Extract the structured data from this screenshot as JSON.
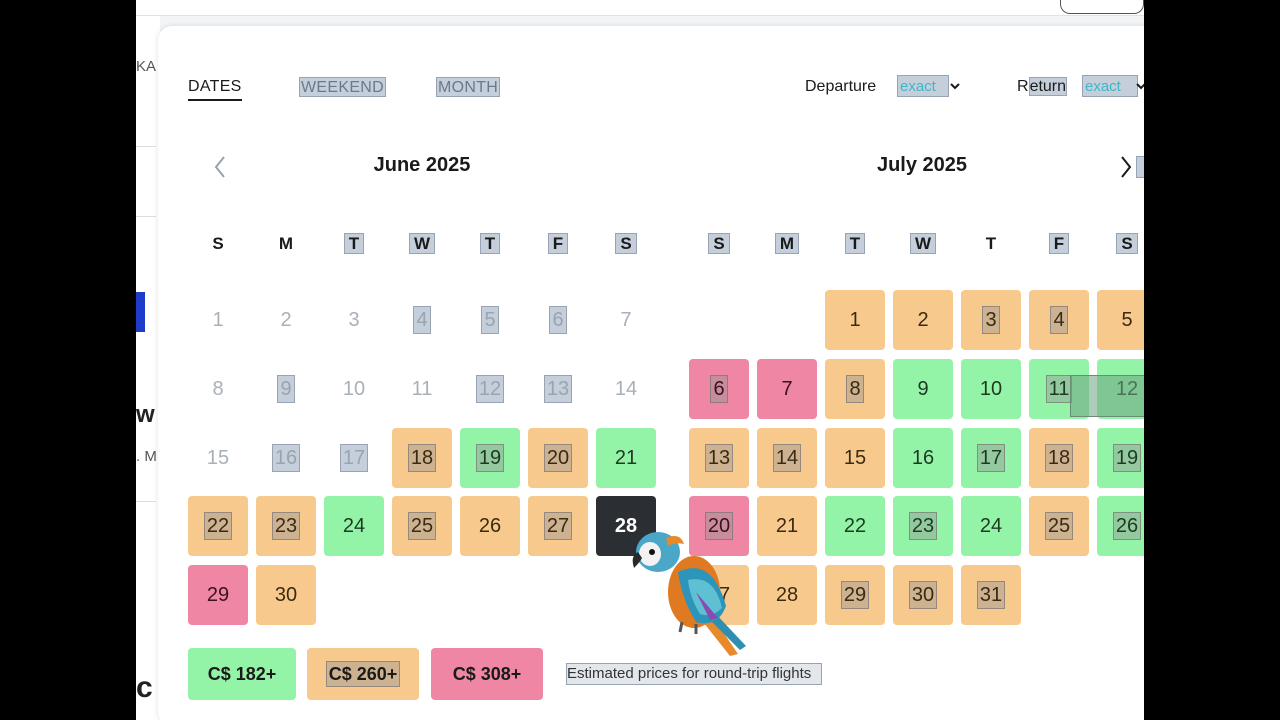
{
  "tabs": [
    {
      "label": "DATES",
      "active": true
    },
    {
      "label": "WEEKEND",
      "active": false
    },
    {
      "label": "MONTH",
      "active": false
    }
  ],
  "flex": {
    "departure_label": "Departure",
    "departure_value": "exact",
    "return_label_pre": "R",
    "return_label_rest": "eturn",
    "return_value": "exact"
  },
  "background_fragments": {
    "ka": "KA",
    "w": "w",
    "m": ". M",
    "c": "c"
  },
  "calendars": [
    {
      "title": "June 2025",
      "weekdays": [
        "S",
        "M",
        "T",
        "W",
        "T",
        "F",
        "S"
      ],
      "days": [
        {
          "d": "1",
          "price": "past"
        },
        {
          "d": "2",
          "price": "past"
        },
        {
          "d": "3",
          "price": "past"
        },
        {
          "d": "4",
          "price": "past"
        },
        {
          "d": "5",
          "price": "past"
        },
        {
          "d": "6",
          "price": "past"
        },
        {
          "d": "7",
          "price": "past"
        },
        {
          "d": "8",
          "price": "past"
        },
        {
          "d": "9",
          "price": "past"
        },
        {
          "d": "10",
          "price": "past"
        },
        {
          "d": "11",
          "price": "past"
        },
        {
          "d": "12",
          "price": "past"
        },
        {
          "d": "13",
          "price": "past"
        },
        {
          "d": "14",
          "price": "past"
        },
        {
          "d": "15",
          "price": "past"
        },
        {
          "d": "16",
          "price": "past"
        },
        {
          "d": "17",
          "price": "past"
        },
        {
          "d": "18",
          "price": "orange"
        },
        {
          "d": "19",
          "price": "green"
        },
        {
          "d": "20",
          "price": "orange"
        },
        {
          "d": "21",
          "price": "green"
        },
        {
          "d": "22",
          "price": "orange"
        },
        {
          "d": "23",
          "price": "orange"
        },
        {
          "d": "24",
          "price": "green"
        },
        {
          "d": "25",
          "price": "orange"
        },
        {
          "d": "26",
          "price": "orange"
        },
        {
          "d": "27",
          "price": "orange"
        },
        {
          "d": "28",
          "price": "selected"
        },
        {
          "d": "29",
          "price": "pink"
        },
        {
          "d": "30",
          "price": "orange"
        }
      ]
    },
    {
      "title": "July 2025",
      "weekdays": [
        "S",
        "M",
        "T",
        "W",
        "T",
        "F",
        "S"
      ],
      "days": [
        {
          "d": "1",
          "price": "orange"
        },
        {
          "d": "2",
          "price": "orange"
        },
        {
          "d": "3",
          "price": "orange"
        },
        {
          "d": "4",
          "price": "orange"
        },
        {
          "d": "5",
          "price": "orange"
        },
        {
          "d": "6",
          "price": "pink"
        },
        {
          "d": "7",
          "price": "pink"
        },
        {
          "d": "8",
          "price": "orange"
        },
        {
          "d": "9",
          "price": "green"
        },
        {
          "d": "10",
          "price": "green"
        },
        {
          "d": "11",
          "price": "green"
        },
        {
          "d": "12",
          "price": "green"
        },
        {
          "d": "13",
          "price": "orange"
        },
        {
          "d": "14",
          "price": "orange"
        },
        {
          "d": "15",
          "price": "orange"
        },
        {
          "d": "16",
          "price": "green"
        },
        {
          "d": "17",
          "price": "green"
        },
        {
          "d": "18",
          "price": "orange"
        },
        {
          "d": "19",
          "price": "green"
        },
        {
          "d": "20",
          "price": "pink"
        },
        {
          "d": "21",
          "price": "orange"
        },
        {
          "d": "22",
          "price": "green"
        },
        {
          "d": "23",
          "price": "green"
        },
        {
          "d": "24",
          "price": "green"
        },
        {
          "d": "25",
          "price": "orange"
        },
        {
          "d": "26",
          "price": "green"
        },
        {
          "d": "27",
          "price": "orange"
        },
        {
          "d": "28",
          "price": "orange"
        },
        {
          "d": "29",
          "price": "orange"
        },
        {
          "d": "30",
          "price": "orange"
        },
        {
          "d": "31",
          "price": "orange"
        }
      ]
    }
  ],
  "legend": {
    "green": "C$ 182+",
    "orange": "C$ 260+",
    "pink": "C$ 308+",
    "note": "Estimated prices for round-trip flights"
  },
  "colors": {
    "green": "#93f3a7",
    "orange": "#f8c98c",
    "pink": "#ef86a3",
    "selected": "#2b2e33",
    "accent": "#3db7c7"
  }
}
